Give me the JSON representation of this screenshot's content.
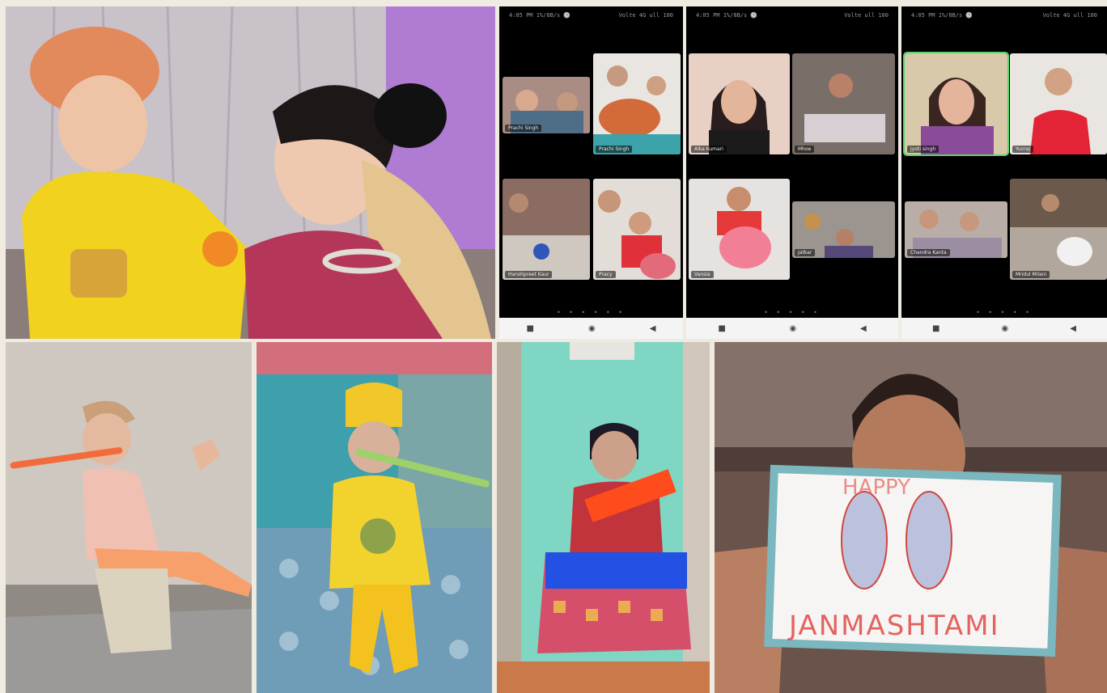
{
  "collage": {
    "photo_top_left": {
      "description_icon": "dressed-up-children-icon"
    },
    "phones": [
      {
        "status_left": "4:05 PM 1%/8B/s 🕑",
        "status_right": "Volte 4G ull 100",
        "feeds": [
          "Prachi Singh",
          "Prachi Singh",
          "Hanshpreet Kaur",
          "Pracy"
        ],
        "dots": "• • • • • •"
      },
      {
        "status_left": "4:05 PM 1%/8B/s 🕑",
        "status_right": "Volte ull 100",
        "feeds": [
          "Alka Kumari",
          "Mhoe",
          "Vansia",
          "Jatkar"
        ],
        "dots": "• • • • •"
      },
      {
        "status_left": "4:05 PM 1%/8B/s 🕑",
        "status_right": "Volte 4G ull 100",
        "feeds": [
          "Jyoti singh",
          "Yuvraj",
          "Chandra Kanta",
          "Mridul Milani"
        ],
        "dots": "• • • • •"
      }
    ],
    "nav_icons": [
      "square-icon",
      "circle-icon",
      "back-triangle-icon"
    ],
    "drawing": {
      "top_text": "HAPPY",
      "bottom_text": "JANMASHTAMI"
    }
  }
}
